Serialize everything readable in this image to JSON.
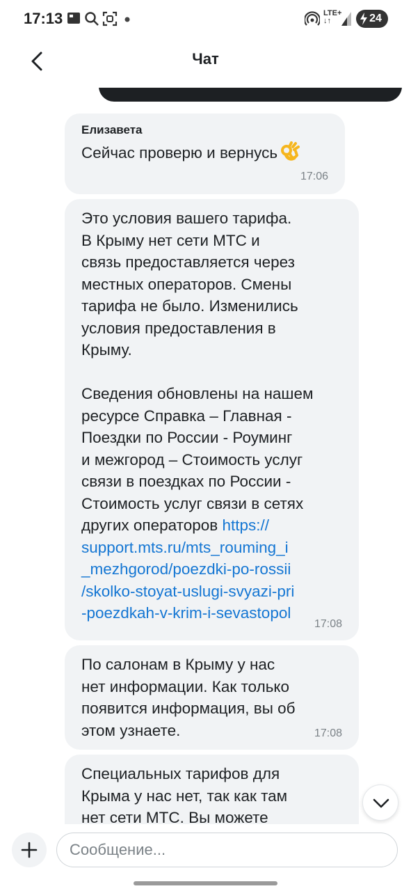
{
  "status_bar": {
    "time": "17:13",
    "network": "LTE+",
    "battery": "24"
  },
  "header": {
    "title": "Чат"
  },
  "messages": [
    {
      "author": "Елизавета",
      "text": "Сейчас проверю и вернусь",
      "emoji": "ok-hand-emoji",
      "time": "17:06"
    },
    {
      "text": "Это условия вашего тарифа.\nВ Крыму нет сети МТС и\nсвязь предоставляется через\nместных операторов. Смены\nтарифа не было. Изменились\nусловия предоставления в\nКрыму.\n\nСведения обновлены на нашем\nресурсе Справка – Главная -\nПоездки по России - Роуминг\nи межгород – Стоимость услуг\nсвязи в поездках по России -\nСтоимость услуг связи в сетях\nдругих операторов ",
      "link": "https://\nsupport.mts.ru/mts_rouming_i\n_mezhgorod/poezdki-po-rossii\n/skolko-stoyat-uslugi-svyazi-pri\n-poezdkah-v-krim-i-sevastopol",
      "time": "17:08"
    },
    {
      "text": "По салонам в Крыму у нас\nнет информации. Как только\nпоявится информация, вы об\nэтом узнаете.",
      "time": "17:08"
    },
    {
      "text": "Специальных тарифов для\nКрыма у нас нет, так как там\nнет сети МТС. Вы можете"
    }
  ],
  "composer": {
    "placeholder": "Сообщение..."
  },
  "colors": {
    "bubble_bg": "#f1f3f5",
    "link": "#1476d3",
    "outgoing_bg": "#1d2023"
  }
}
